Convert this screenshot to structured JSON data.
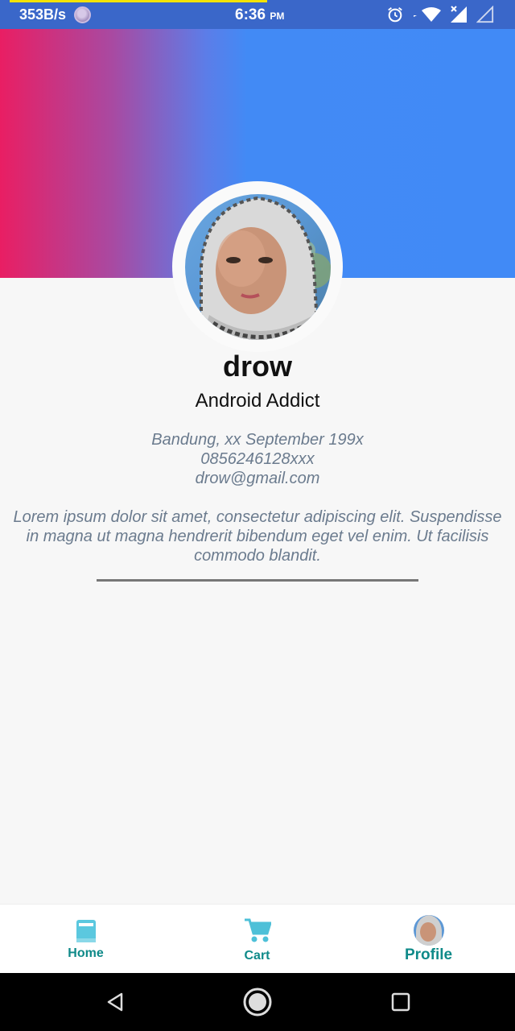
{
  "status_bar": {
    "speed": "353B/s",
    "time": "6:36",
    "ampm": "PM",
    "icons": [
      "alarm-icon",
      "wifi-icon",
      "signal-icon",
      "signal-empty-icon"
    ]
  },
  "profile": {
    "name": "drow",
    "title": "Android Addict",
    "birth": "Bandung, xx September 199x",
    "phone": "0856246128xxx",
    "email": "drow@gmail.com",
    "bio": "Lorem ipsum dolor sit amet, consectetur adipiscing elit. Suspendisse in magna ut magna hendrerit bibendum eget vel enim. Ut facilisis commodo blandit."
  },
  "bottom_nav": {
    "items": [
      {
        "label": "Home",
        "icon": "book-icon"
      },
      {
        "label": "Cart",
        "icon": "cart-icon"
      },
      {
        "label": "Profile",
        "icon": "avatar-icon"
      }
    ],
    "active": "Profile"
  },
  "colors": {
    "header_gradient_start": "#e91e63",
    "header_gradient_end": "#418af6",
    "accent": "#0f8a89",
    "status_bar": "#3a67c9"
  }
}
